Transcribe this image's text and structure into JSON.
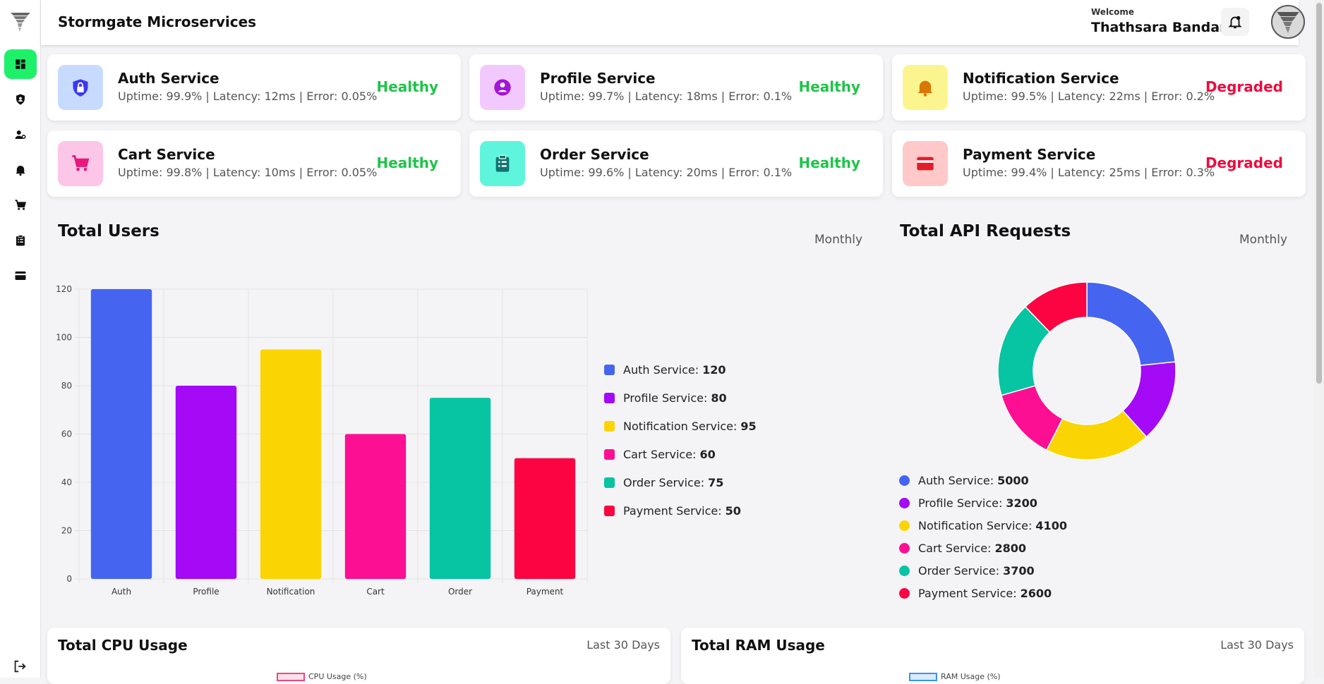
{
  "app": {
    "title": "Stormgate Microservices"
  },
  "user": {
    "welcome": "Welcome",
    "name": "Thathsara Bandara"
  },
  "sidebar": {
    "items": [
      {
        "icon": "dashboard-icon",
        "active": true
      },
      {
        "icon": "shield-user-icon",
        "active": false
      },
      {
        "icon": "user-settings-icon",
        "active": false
      },
      {
        "icon": "bell-icon",
        "active": false
      },
      {
        "icon": "cart-icon",
        "active": false
      },
      {
        "icon": "clipboard-icon",
        "active": false
      },
      {
        "icon": "credit-card-icon",
        "active": false
      }
    ],
    "logout_icon": "logout-icon"
  },
  "services": [
    {
      "name": "Auth Service",
      "stats": "Uptime: 99.9%  | Latency: 12ms  | Error: 0.05%",
      "status": "Healthy",
      "icon": "lock-icon",
      "icon_bg": "#c6dbff",
      "icon_color": "#3a37f5"
    },
    {
      "name": "Profile Service",
      "stats": "Uptime: 99.7%  | Latency: 18ms  | Error: 0.1%",
      "status": "Healthy",
      "icon": "profile-icon",
      "icon_bg": "#f2c9ff",
      "icon_color": "#a314d8"
    },
    {
      "name": "Notification Service",
      "stats": "Uptime: 99.5%  | Latency: 22ms  | Error: 0.2%",
      "status": "Degraded",
      "icon": "bell-icon",
      "icon_bg": "#fcf58f",
      "icon_color": "#d97706"
    },
    {
      "name": "Cart Service",
      "stats": "Uptime: 99.8%  | Latency: 10ms  | Error: 0.05%",
      "status": "Healthy",
      "icon": "cart-icon",
      "icon_bg": "#fcc6e8",
      "icon_color": "#e8187c"
    },
    {
      "name": "Order Service",
      "stats": "Uptime: 99.6%  | Latency: 20ms  | Error: 0.1%",
      "status": "Healthy",
      "icon": "clipboard-icon",
      "icon_bg": "#5ff5dc",
      "icon_color": "#0f766e"
    },
    {
      "name": "Payment Service",
      "stats": "Uptime: 99.4%  | Latency: 25ms  | Error: 0.3%",
      "status": "Degraded",
      "icon": "credit-card-icon",
      "icon_bg": "#ffc9c9",
      "icon_color": "#e11d2a"
    }
  ],
  "status_colors": {
    "Healthy": "#1fc44a",
    "Degraded": "#ee0a3f"
  },
  "users_panel": {
    "title": "Total Users",
    "period": "Monthly"
  },
  "api_panel": {
    "title": "Total API Requests",
    "period": "Monthly"
  },
  "cpu_panel": {
    "title": "Total CPU Usage",
    "period": "Last 30 Days",
    "legend": "CPU Usage (%)",
    "color": "#f2467f"
  },
  "ram_panel": {
    "title": "Total RAM Usage",
    "period": "Last 30 Days",
    "legend": "RAM Usage (%)",
    "color": "#3a95e8"
  },
  "chart_data": [
    {
      "type": "bar",
      "categories": [
        "Auth",
        "Profile",
        "Notification",
        "Cart",
        "Order",
        "Payment"
      ],
      "values": [
        120,
        80,
        95,
        60,
        75,
        50
      ],
      "colors": [
        "#4565f1",
        "#a40af5",
        "#fbd404",
        "#fc0f93",
        "#07c4a3",
        "#fc0441"
      ],
      "legend": [
        "Auth Service",
        "Profile Service",
        "Notification Service",
        "Cart Service",
        "Order Service",
        "Payment Service"
      ],
      "ylim": [
        0,
        120
      ],
      "yticks": [
        0,
        20,
        40,
        60,
        80,
        100,
        120
      ],
      "grid": true
    },
    {
      "type": "pie",
      "donut": true,
      "labels": [
        "Auth Service",
        "Profile Service",
        "Notification Service",
        "Cart Service",
        "Order Service",
        "Payment Service"
      ],
      "values": [
        5000,
        3200,
        4100,
        2800,
        3700,
        2600
      ],
      "colors": [
        "#4565f1",
        "#a40af5",
        "#fbd404",
        "#fc0f93",
        "#07c4a3",
        "#fc0441"
      ]
    }
  ]
}
